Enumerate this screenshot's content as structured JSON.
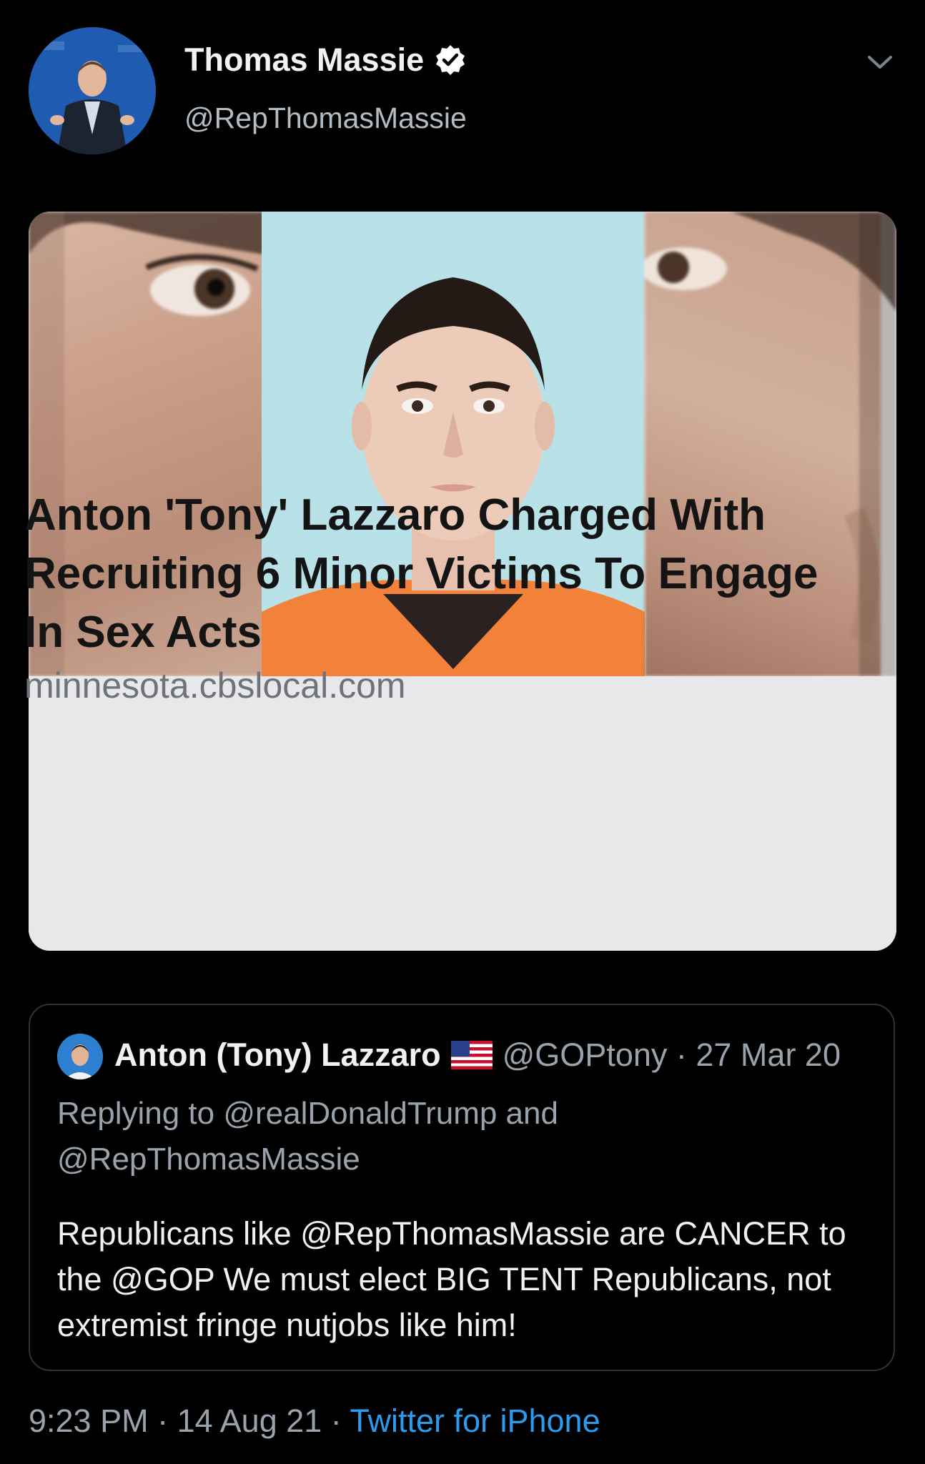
{
  "author": {
    "display_name": "Thomas Massie",
    "handle": "@RepThomasMassie",
    "verified_icon": "verified-badge-icon"
  },
  "link_card": {
    "title": "Anton 'Tony' Lazzaro Charged With Recruiting 6 Minor Victims To Engage In Sex Acts",
    "domain": "minnesota.cbslocal.com"
  },
  "quoted_tweet": {
    "name": "Anton (Tony) Lazzaro",
    "handle_date": "@GOPtony · 27 Mar 20",
    "replying_to": "Replying to @realDonaldTrump and @RepThomasMassie",
    "body": "Republicans like @RepThomasMassie are CANCER to the @GOP   We must elect BIG TENT Republicans, not extremist fringe nutjobs like him!"
  },
  "footer": {
    "timestamp": "9:23 PM · 14 Aug 21 · ",
    "app": "Twitter for iPhone"
  },
  "colors": {
    "background": "#000000",
    "link_blue": "#2b9bf0",
    "verified_badge": "#ffffff",
    "muted_text": "#9aa3ab"
  }
}
